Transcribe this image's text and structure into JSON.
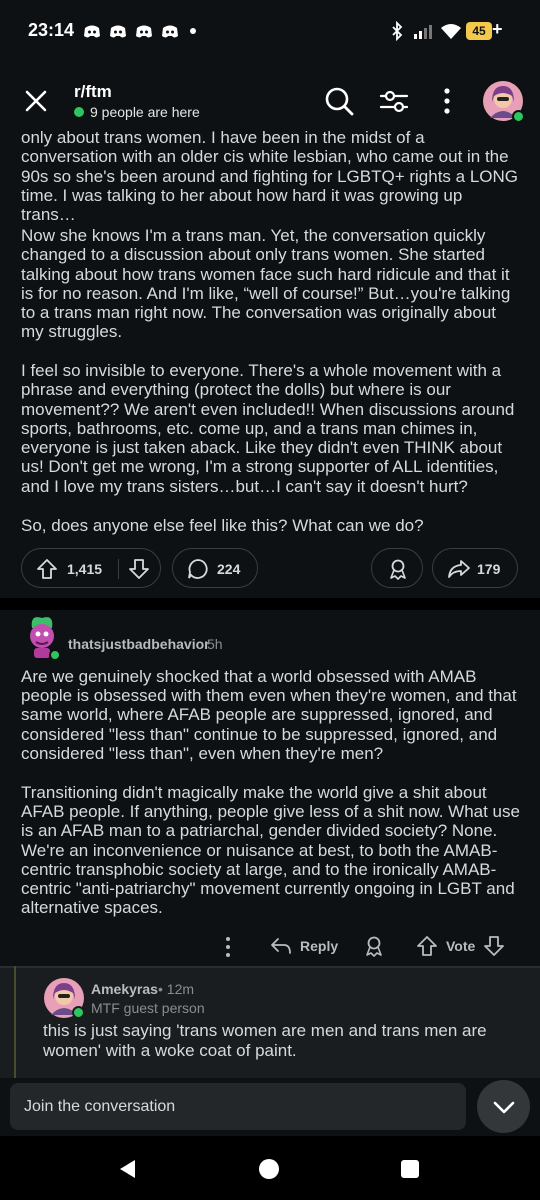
{
  "status_bar": {
    "time": "23:14",
    "battery": "45",
    "battery_plus": "+"
  },
  "header": {
    "title": "r/ftm",
    "online": "9 people are here"
  },
  "post": {
    "paragraphs": [
      "only about trans women. I have been in the midst of a conversation with an older cis white lesbian, who came out in the 90s so she's been around and fighting for LGBTQ+ rights a LONG time. I was talking to her about how hard it was growing up trans…",
      "Now she knows I'm a trans man. Yet, the conversation quickly changed to a discussion about only trans women. She started talking about how trans women face such hard ridicule and that it is for no reason. And I'm like, “well of course!” But…you're talking to a trans man right now. The conversation was originally about my struggles.",
      "I feel so invisible to everyone. There's a whole movement with a phrase and everything (protect the dolls) but where is our movement?? We aren't even included!! When discussions around sports, bathrooms, etc. come up, and a trans man chimes in, everyone is just taken aback. Like they didn't even THINK about us! Don't get me wrong, I'm a strong supporter of ALL identities, and I love my trans sisters…but…I can't say it doesn't hurt?",
      "So, does anyone else feel like this? What can we do?"
    ],
    "votes": "1,415",
    "comments": "224",
    "shares": "179"
  },
  "comment": {
    "author": "thatsjustbadbehavior",
    "age": "5h",
    "paragraphs": [
      "Are we genuinely shocked that a world obsessed with AMAB people is obsessed with them even when they're women, and that same world, where AFAB people are suppressed, ignored, and considered \"less than\" continue to be suppressed, ignored, and considered \"less than\", even when they're men?",
      "Transitioning didn't magically make the world give a shit about AFAB people. If anything, people give less of a shit now. What use is an AFAB man to a patriarchal, gender divided society? None. We're an inconvenience or nuisance at best, to both the AMAB-centric transphobic society at large, and to the ironically AMAB-centric \"anti-patriarchy\" movement currently ongoing in LGBT and alternative spaces."
    ],
    "reply_label": "Reply",
    "vote_label": "Vote"
  },
  "reply": {
    "author": "Amekyras",
    "age": "12m",
    "flair": "MTF guest person",
    "text": "this is just saying 'trans women are men and trans men are women' with a woke coat of paint."
  },
  "composer": {
    "placeholder": "Join the conversation"
  }
}
